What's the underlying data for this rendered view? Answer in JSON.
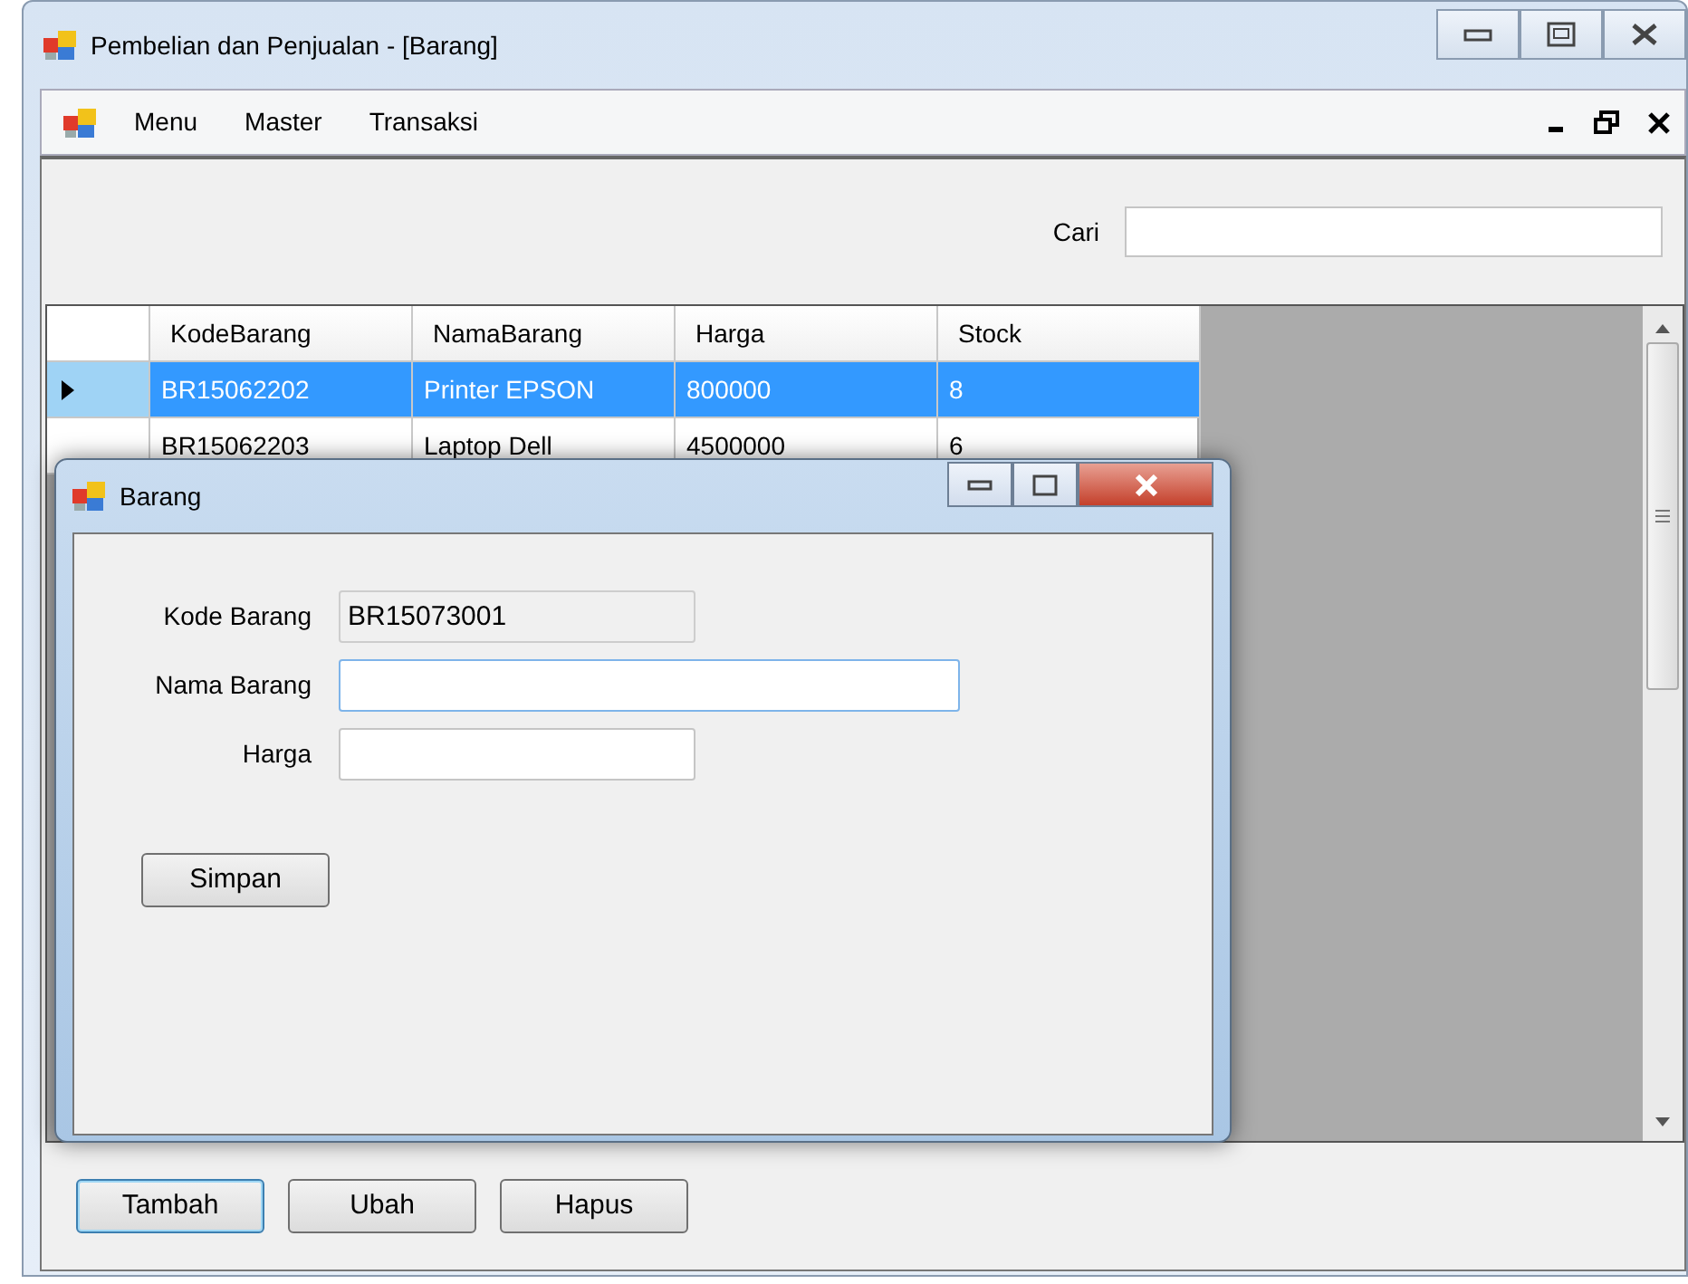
{
  "window": {
    "title": "Pembelian dan Penjualan - [Barang]"
  },
  "menu": [
    {
      "label": "Menu"
    },
    {
      "label": "Master"
    },
    {
      "label": "Transaksi"
    }
  ],
  "search": {
    "label": "Cari"
  },
  "table": {
    "columns": [
      "KodeBarang",
      "NamaBarang",
      "Harga",
      "Stock"
    ],
    "rows": [
      {
        "cells": [
          "BR15062202",
          "Printer EPSON",
          "800000",
          "8"
        ],
        "selected": true
      },
      {
        "cells": [
          "BR15062203",
          "Laptop Dell",
          "4500000",
          "6"
        ],
        "selected": false
      }
    ]
  },
  "dialog": {
    "title": "Barang",
    "fields": [
      {
        "label": "Kode Barang",
        "value": "BR15073001",
        "readonly": true,
        "focused": false,
        "wide": false
      },
      {
        "label": "Nama Barang",
        "readonly": false,
        "focused": true,
        "wide": true
      },
      {
        "label": "Harga",
        "readonly": false,
        "focused": false,
        "wide": false
      }
    ],
    "button": "Simpan"
  },
  "buttons": [
    {
      "label": "Tambah",
      "focused": true
    },
    {
      "label": "Ubah",
      "focused": false
    },
    {
      "label": "Hapus",
      "focused": false
    }
  ]
}
